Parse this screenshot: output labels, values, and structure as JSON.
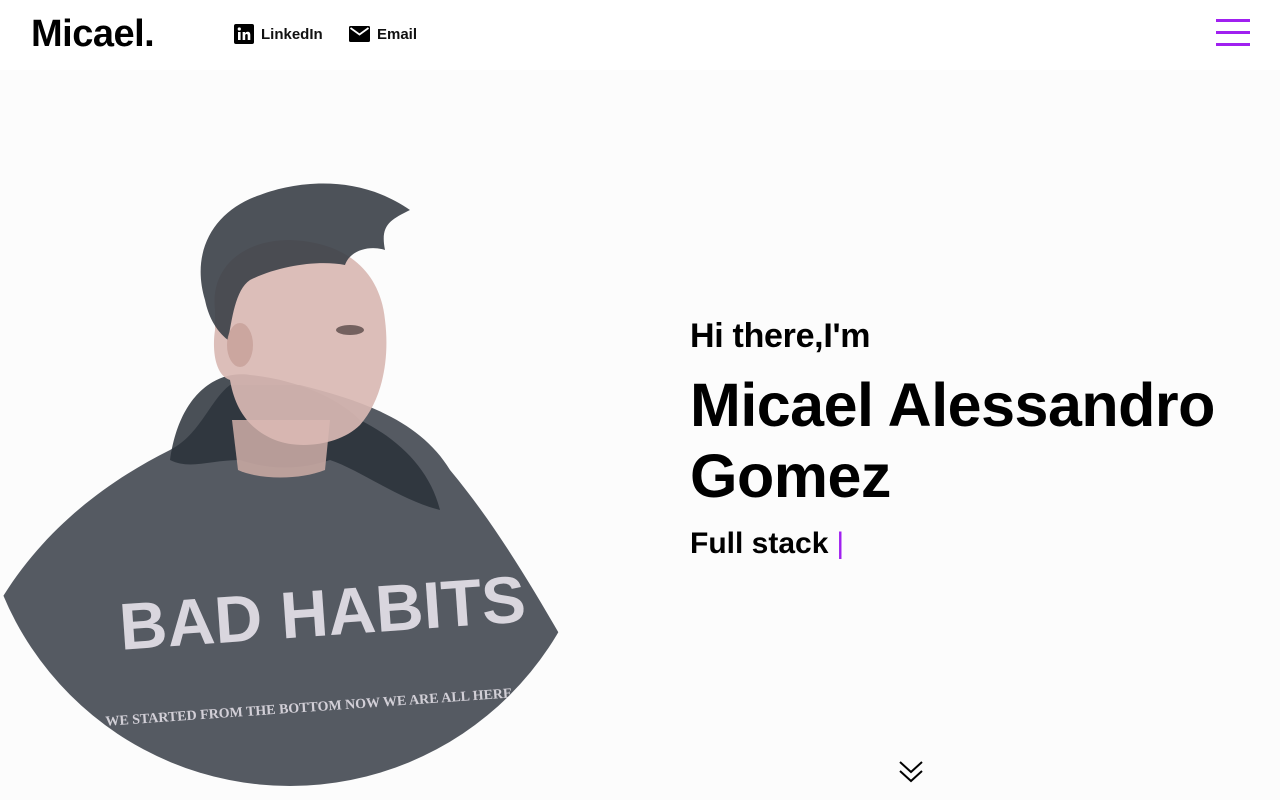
{
  "header": {
    "logo": "Micael.",
    "links": [
      {
        "label": "LinkedIn",
        "icon": "linkedin-icon"
      },
      {
        "label": "Email",
        "icon": "email-icon"
      }
    ],
    "menu_icon": "hamburger-menu-icon",
    "accent_color": "#a020f0"
  },
  "hero": {
    "greeting": "Hi there,I'm",
    "name": "Micael Alessandro Gomez",
    "role": "Full stack",
    "cursor": "|",
    "photo": {
      "alt": "Portrait of Micael wearing a dark hoodie",
      "hoodie_text": "BAD HABITS",
      "hoodie_subtext": "WE STARTED FROM THE BOTTOM NOW WE ARE ALL HERE"
    },
    "scroll_icon": "double-chevron-down-icon"
  }
}
